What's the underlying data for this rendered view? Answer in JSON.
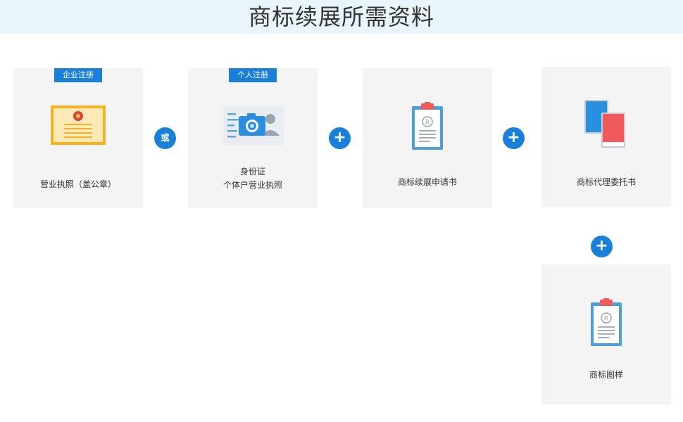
{
  "page_title": "商标续展所需资料",
  "cards": {
    "business_license": {
      "tag": "企业注册",
      "label": "营业执照（盖公章）",
      "icon": "license-certificate-icon"
    },
    "id_card": {
      "tag": "个人注册",
      "label_line1": "身份证",
      "label_line2": "个体户营业执照",
      "icon": "id-card-camera-icon"
    },
    "renewal_application": {
      "label": "商标续展申请书",
      "icon": "clipboard-registered-icon"
    },
    "power_of_attorney": {
      "label": "商标代理委托书",
      "icon": "books-icon"
    },
    "trademark_sample": {
      "label": "商标图样",
      "icon": "clipboard-registered-icon"
    }
  },
  "connectors": {
    "or_label": "或",
    "plus_label": "+"
  },
  "colors": {
    "accent": "#1a7fd8",
    "card_bg": "#f4f4f4",
    "header_bg": "#eaf5fb",
    "gold": "#f5b324",
    "red": "#f05a5a"
  }
}
